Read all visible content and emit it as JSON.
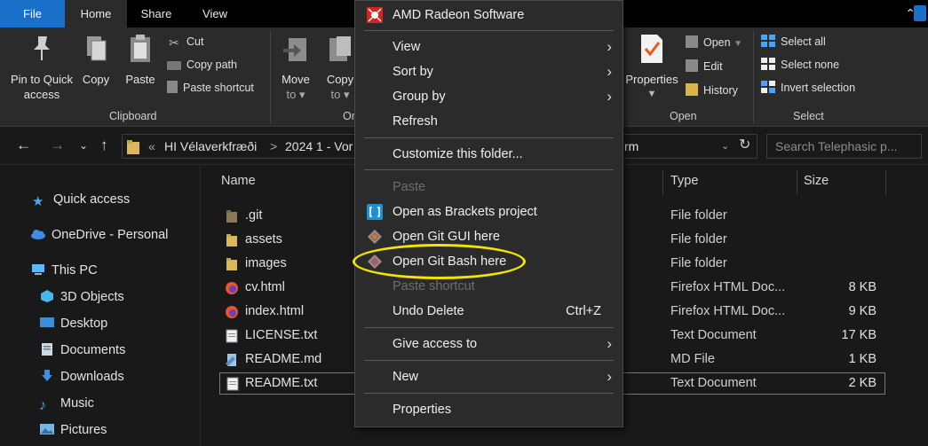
{
  "ribbon_tabs": [
    "File",
    "Home",
    "Share",
    "View"
  ],
  "clipboard": {
    "group_label": "Clipboard",
    "pin_label_1": "Pin to Quick",
    "pin_label_2": "access",
    "copy": "Copy",
    "paste": "Paste",
    "cut": "Cut",
    "copy_path": "Copy path",
    "paste_shortcut": "Paste shortcut"
  },
  "organize": {
    "move_to_1": "Move",
    "move_to_2": "to",
    "copy_to_1": "Copy",
    "copy_to_2": "to",
    "group_label_partial": "Or"
  },
  "open_group": {
    "group_label": "Open",
    "properties": "Properties",
    "open": "Open",
    "edit": "Edit",
    "history": "History"
  },
  "select_group": {
    "group_label": "Select",
    "select_all": "Select all",
    "select_none": "Select none",
    "invert_selection": "Invert selection"
  },
  "address": {
    "breadcrumb_prefix": "«",
    "crumb1": "HI Vélaverkfræði",
    "crumb_sep": ">",
    "crumb2": "2024 1 - Vor",
    "crumb_tail": "rm",
    "search_placeholder": "Search Telephasic p..."
  },
  "nav": [
    {
      "label": "Quick access"
    },
    {
      "label": "OneDrive - Personal"
    },
    {
      "label": "This PC"
    },
    {
      "label": "3D Objects"
    },
    {
      "label": "Desktop"
    },
    {
      "label": "Documents"
    },
    {
      "label": "Downloads"
    },
    {
      "label": "Music"
    },
    {
      "label": "Pictures"
    }
  ],
  "columns": {
    "name": "Name",
    "type": "Type",
    "size": "Size"
  },
  "files": [
    {
      "name": ".git",
      "type": "File folder",
      "size": "",
      "icon": "folder-icon"
    },
    {
      "name": "assets",
      "type": "File folder",
      "size": "",
      "icon": "folder-icon"
    },
    {
      "name": "images",
      "type": "File folder",
      "size": "",
      "icon": "folder-icon"
    },
    {
      "name": "cv.html",
      "type": "Firefox HTML Doc...",
      "size": "8 KB",
      "icon": "firefox-icon"
    },
    {
      "name": "index.html",
      "type": "Firefox HTML Doc...",
      "size": "9 KB",
      "icon": "firefox-icon"
    },
    {
      "name": "LICENSE.txt",
      "type": "Text Document",
      "size": "17 KB",
      "icon": "text-file-icon"
    },
    {
      "name": "README.md",
      "type": "MD File",
      "size": "1 KB",
      "icon": "md-file-icon"
    },
    {
      "name": "README.txt",
      "type": "Text Document",
      "size": "2 KB",
      "icon": "text-file-icon"
    }
  ],
  "context_menu": {
    "amd": "AMD Radeon Software",
    "view": "View",
    "sort_by": "Sort by",
    "group_by": "Group by",
    "refresh": "Refresh",
    "customize": "Customize this folder...",
    "paste": "Paste",
    "brackets": "Open as Brackets project",
    "git_gui": "Open Git GUI here",
    "git_bash": "Open Git Bash here",
    "paste_shortcut": "Paste shortcut",
    "undo_delete": "Undo Delete",
    "undo_shortcut": "Ctrl+Z",
    "give_access": "Give access to",
    "new": "New",
    "properties": "Properties"
  },
  "colors": {
    "accent": "#1a6fc9",
    "highlight_circle": "#f2e600",
    "folder": "#dcb85a"
  }
}
